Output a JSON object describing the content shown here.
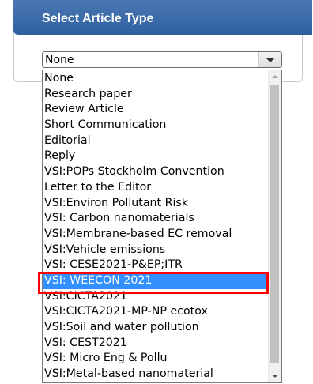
{
  "panel": {
    "title": "Select Article Type"
  },
  "select": {
    "value": "None"
  },
  "dropdown": {
    "options": [
      "None",
      "Research paper",
      "Review Article",
      "Short Communication",
      "Editorial",
      "Reply",
      "VSI:POPs Stockholm Convention",
      "Letter to the Editor",
      "VSI:Environ Pollutant Risk",
      "VSI: Carbon nanomaterials",
      "VSI:Membrane-based EC removal",
      "VSI:Vehicle emissions",
      "VSI: CESE2021-P&EP;ITR",
      "VSI: WEECON 2021",
      "VSI:CICTA2021",
      "VSI:CICTA2021-MP-NP ecotox",
      "VSI:Soil and water pollution",
      "VSI: CEST2021",
      "VSI: Micro Eng & Pollu",
      "VSI:Metal-based nanomaterial"
    ],
    "highlighted_option": "VSI: WEECON 2021"
  },
  "colors": {
    "header": "#2e5f9f",
    "selection": "#3390ff",
    "annotation": "#ff0000"
  }
}
